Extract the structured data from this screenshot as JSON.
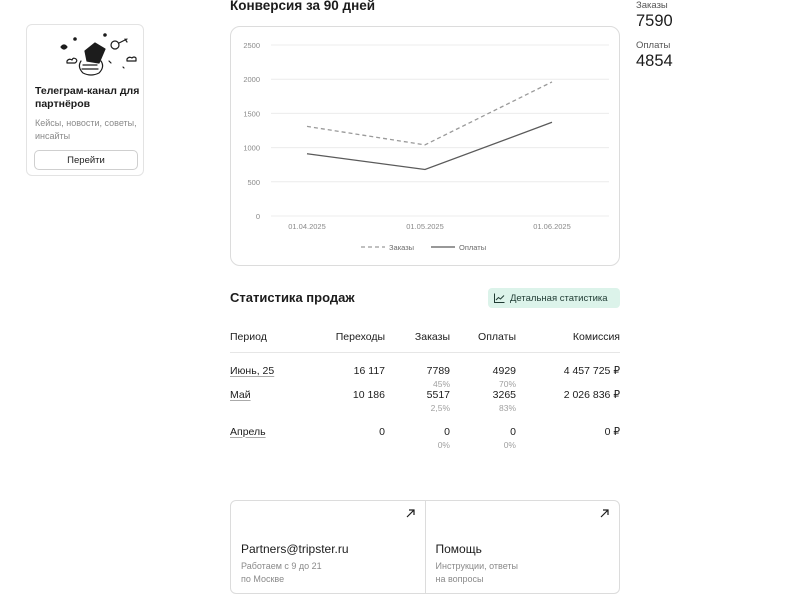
{
  "promo": {
    "title": "Телеграм-канал для партнёров",
    "description": "Кейсы, новости, советы, инсайты",
    "button": "Перейти"
  },
  "conversion": {
    "title": "Конверсия за 90 дней"
  },
  "summary": {
    "orders_label": "Заказы",
    "orders_value": "7590",
    "payments_label": "Оплаты",
    "payments_value": "4854"
  },
  "chart_data": {
    "type": "line",
    "x": [
      "01.04.2025",
      "01.05.2025",
      "01.06.2025"
    ],
    "series": [
      {
        "name": "Заказы",
        "values": [
          1310,
          1040,
          1960
        ],
        "style": "dashed",
        "color": "#9a9a9a"
      },
      {
        "name": "Оплаты",
        "values": [
          910,
          680,
          1370
        ],
        "style": "solid",
        "color": "#5a5a5a"
      }
    ],
    "y_ticks": [
      0,
      500,
      1000,
      1500,
      2000,
      2500
    ],
    "ylim": [
      0,
      2500
    ],
    "grid": true,
    "legend": "bottom"
  },
  "sales": {
    "title": "Статистика продаж",
    "detail_button": "Детальная статистика",
    "columns": [
      "Период",
      "Переходы",
      "Заказы",
      "Оплаты",
      "Комиссия"
    ],
    "rows": [
      {
        "period": "Июнь, 25",
        "visits": "16 117",
        "orders": "7789",
        "orders_pct": "45%",
        "payments": "4929",
        "payments_pct": "70%",
        "commission": "4 457 725 ₽"
      },
      {
        "period": "Май",
        "visits": "10 186",
        "orders": "5517",
        "orders_pct": "2,5%",
        "payments": "3265",
        "payments_pct": "83%",
        "commission": "2 026 836 ₽"
      },
      {
        "period": "Апрель",
        "visits": "0",
        "orders": "0",
        "orders_pct": "0%",
        "payments": "0",
        "payments_pct": "0%",
        "commission": "0 ₽"
      }
    ]
  },
  "contacts": [
    {
      "title": "Partners@tripster.ru",
      "subtitle_line1": "Работаем с 9 до 21",
      "subtitle_line2": "по Москве"
    },
    {
      "title": "Помощь",
      "subtitle_line1": "Инструкции, ответы",
      "subtitle_line2": "на вопросы"
    }
  ],
  "colors": {
    "accent_bg": "#dcf3ea",
    "border": "#dcdcdc",
    "muted_text": "#8a8a8a"
  }
}
